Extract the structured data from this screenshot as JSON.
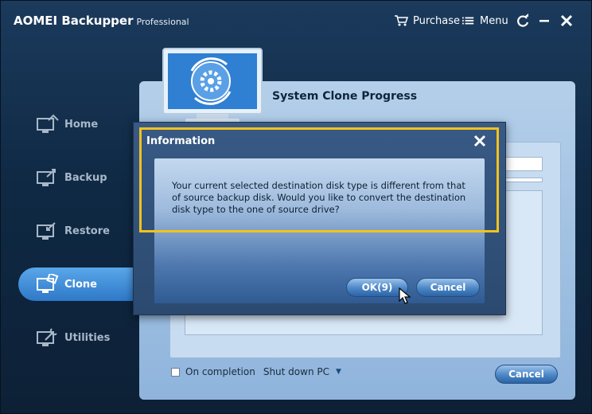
{
  "app": {
    "title": "AOMEI Backupper",
    "edition": "Professional",
    "purchase_label": "Purchase",
    "menu_label": "Menu"
  },
  "sidebar": {
    "items": [
      {
        "label": "Home",
        "icon": "home-icon",
        "active": false
      },
      {
        "label": "Backup",
        "icon": "backup-icon",
        "active": false
      },
      {
        "label": "Restore",
        "icon": "restore-icon",
        "active": false
      },
      {
        "label": "Clone",
        "icon": "clone-icon",
        "active": true
      },
      {
        "label": "Utilities",
        "icon": "utilities-icon",
        "active": false
      }
    ]
  },
  "main": {
    "title": "System Clone Progress",
    "on_completion_label": "On completion",
    "on_completion_value": "Shut down PC",
    "cancel_label": "Cancel"
  },
  "dialog": {
    "title": "Information",
    "message": "Your current selected destination disk type is different from that of source backup disk. Would you like to convert the destination disk type to the one of source drive?",
    "ok_label": "OK(9)",
    "cancel_label": "Cancel"
  },
  "colors": {
    "accent": "#2e78c8",
    "highlight": "#f2c21d",
    "panel": "#b4cfe9"
  }
}
